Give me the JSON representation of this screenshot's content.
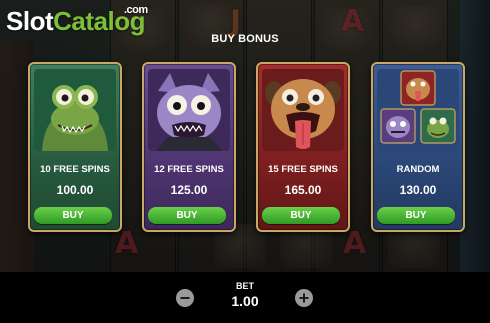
{
  "logo": {
    "slot": "Slot",
    "catalog": "Catalog",
    "dotcom": ".com"
  },
  "title": "BUY BONUS",
  "cards": [
    {
      "label": "10 FREE SPINS",
      "price": "100.00",
      "buy": "BUY",
      "icon": "green-lizard-icon",
      "color": "#2f6a49"
    },
    {
      "label": "12 FREE SPINS",
      "price": "125.00",
      "buy": "BUY",
      "icon": "purple-cat-icon",
      "color": "#5a3d7e"
    },
    {
      "label": "15 FREE SPINS",
      "price": "165.00",
      "buy": "BUY",
      "icon": "pug-dog-icon",
      "color": "#8e2424"
    },
    {
      "label": "RANDOM",
      "price": "130.00",
      "buy": "BUY",
      "icon": "random-mix-icon",
      "color": "#324f85"
    }
  ],
  "bet": {
    "label": "BET",
    "value": "1.00"
  },
  "colors": {
    "buy_button": "#3cae2e",
    "logo_accent": "#7cc03a",
    "card_border": "#c9a866"
  }
}
